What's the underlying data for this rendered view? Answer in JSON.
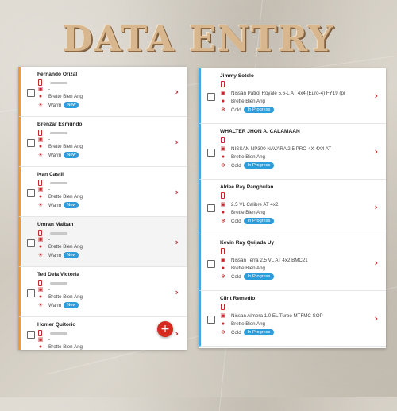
{
  "page_title": "DATA ENTRY",
  "colors": {
    "accent_red": "#c1272d",
    "badge_blue": "#2d9cdb",
    "warm_border": "#f29a2e",
    "cold_border": "#46a8dd"
  },
  "icons": {
    "phone": "phone-icon",
    "car": "car-icon",
    "user": "person-icon",
    "warm": "sun-icon",
    "cold": "snowflake-icon",
    "chevron": "chevron-right-icon",
    "add": "plus-icon"
  },
  "left_cards": [
    {
      "name": "Fernando Orizal",
      "vehicle": "-",
      "agent": "Brette Bien Ang",
      "temp": "Warm",
      "status": "New"
    },
    {
      "name": "Brenzar Esmundo",
      "vehicle": "-",
      "agent": "Brette Bien Ang",
      "temp": "Warm",
      "status": "New"
    },
    {
      "name": "Ivan Castil",
      "vehicle": "-",
      "agent": "Brette Bien Ang",
      "temp": "Warm",
      "status": "New"
    },
    {
      "name": "Umran Malban",
      "vehicle": "-",
      "agent": "Brette Bien Ang",
      "temp": "Warm",
      "status": "New"
    },
    {
      "name": "Ted Dela Victoria",
      "vehicle": "-",
      "agent": "Brette Bien Ang",
      "temp": "Warm",
      "status": "New"
    },
    {
      "name": "Homer Quitorio",
      "vehicle": "-",
      "agent": "Brette Bien Ang",
      "temp": "",
      "status": ""
    }
  ],
  "right_cards": [
    {
      "name": "Jimmy Sotelo",
      "vehicle": "Nissan Patrol Royale 5.6-L AT 4x4 (Euro-4) FY19 (pi",
      "agent": "Brette Bien Ang",
      "temp": "Cold",
      "status": "In Progress"
    },
    {
      "name": "WHALTER JHON A. CALAMAAN",
      "vehicle": "NISSAN NP300 NAVARA 2.5 PRO-4X 4X4 AT",
      "agent": "Brette Bien Ang",
      "temp": "Cold",
      "status": "In Progress"
    },
    {
      "name": "Aldee Ray Panghulan",
      "vehicle": "2.5 VL Calibre AT 4x2",
      "agent": "Brette Bien Ang",
      "temp": "Cold",
      "status": "In Progress"
    },
    {
      "name": "Kevin Ray Quijada Uy",
      "vehicle": "Nissan Terra 2.5 VL AT 4x2 BMC21",
      "agent": "Brette Bien Ang",
      "temp": "Cold",
      "status": "In Progress"
    },
    {
      "name": "Clint Remedio",
      "vehicle": "Nissan Almera 1.0 EL Turbo MTFMC SOP",
      "agent": "Brette Bien Ang",
      "temp": "Cold",
      "status": "In Progress"
    }
  ],
  "fab_label": "+"
}
